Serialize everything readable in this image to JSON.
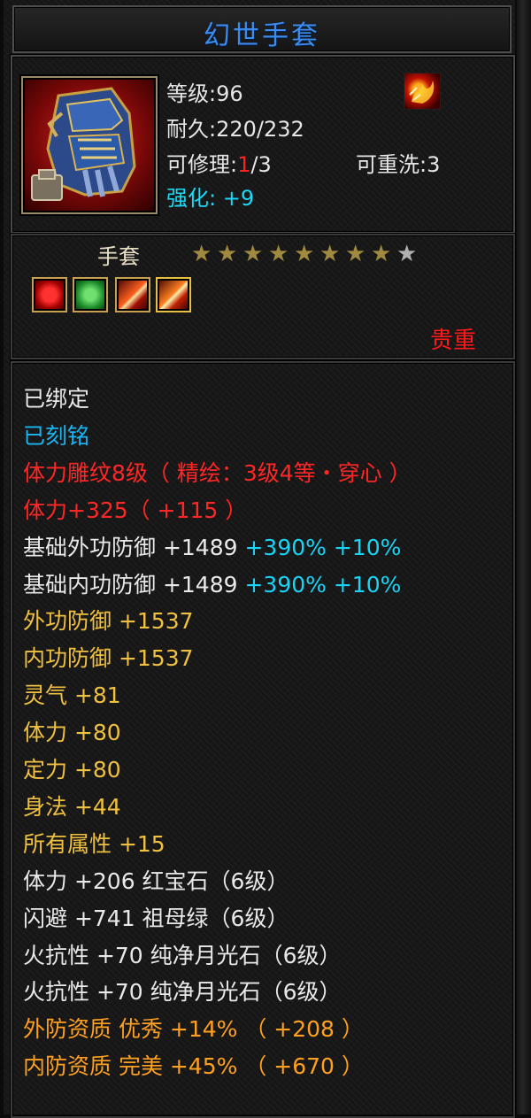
{
  "item": {
    "name": "幻世手套",
    "level_label": "等级:",
    "level": "96",
    "durability_label": "耐久:",
    "durability": "220/232",
    "repair_label": "可修理:",
    "repair_used": "1",
    "repair_total": "/3",
    "rewash_label": "可重洗:",
    "rewash": "3",
    "enhance_label": "强化:",
    "enhance": " +9",
    "type": "手套",
    "stars_filled": 8,
    "stars_total": 9,
    "precious": "贵重",
    "icon": "gauntlet-item-icon",
    "rune_icon": "fire-rune-icon",
    "gem_icons": [
      "red-gem-icon",
      "green-gem-icon",
      "fire-gem-icon",
      "gold-fire-gem-icon"
    ]
  },
  "attributes": [
    {
      "parts": [
        {
          "text": "已绑定",
          "color": "#e9e9e9"
        }
      ]
    },
    {
      "parts": [
        {
          "text": "已刻铭",
          "color": "#19b6f2"
        }
      ]
    },
    {
      "parts": [
        {
          "text": "体力雕纹8级（ 精绘：3级4等・穿心 ）",
          "color": "#ff2626"
        }
      ]
    },
    {
      "parts": [
        {
          "text": "体力+325（ +115 ）",
          "color": "#ff2626"
        }
      ]
    },
    {
      "parts": [
        {
          "text": "基础外功防御  +1489 ",
          "color": "#e9e9e9"
        },
        {
          "text": "+390% +10%",
          "color": "#1ad4f5"
        }
      ]
    },
    {
      "parts": [
        {
          "text": "基础内功防御  +1489 ",
          "color": "#e9e9e9"
        },
        {
          "text": "+390% +10%",
          "color": "#1ad4f5"
        }
      ]
    },
    {
      "parts": [
        {
          "text": "外功防御  +1537",
          "color": "#f0c040"
        }
      ]
    },
    {
      "parts": [
        {
          "text": "内功防御  +1537",
          "color": "#f0c040"
        }
      ]
    },
    {
      "parts": [
        {
          "text": "灵气  +81",
          "color": "#f0c040"
        }
      ]
    },
    {
      "parts": [
        {
          "text": "体力  +80",
          "color": "#f0c040"
        }
      ]
    },
    {
      "parts": [
        {
          "text": "定力  +80",
          "color": "#f0c040"
        }
      ]
    },
    {
      "parts": [
        {
          "text": "身法  +44",
          "color": "#f0c040"
        }
      ]
    },
    {
      "parts": [
        {
          "text": "所有属性  +15",
          "color": "#f0c040"
        }
      ]
    },
    {
      "parts": [
        {
          "text": "体力  +206  红宝石（6级）",
          "color": "#e9e9e9"
        }
      ]
    },
    {
      "parts": [
        {
          "text": "闪避  +741  祖母绿（6级）",
          "color": "#e9e9e9"
        }
      ]
    },
    {
      "parts": [
        {
          "text": "火抗性  +70  纯净月光石（6级）",
          "color": "#e9e9e9"
        }
      ]
    },
    {
      "parts": [
        {
          "text": "火抗性  +70  纯净月光石（6级）",
          "color": "#e9e9e9"
        }
      ]
    },
    {
      "parts": [
        {
          "text": "外防资质   优秀  +14% （ +208 ）",
          "color": "#ffa020"
        }
      ]
    },
    {
      "parts": [
        {
          "text": "内防资质   完美  +45% （ +670 ）",
          "color": "#ffa020"
        }
      ]
    }
  ],
  "colors": {
    "title": "#3c8cf0",
    "star_filled": "#a08a40",
    "star_empty": "#b0b0b0"
  }
}
